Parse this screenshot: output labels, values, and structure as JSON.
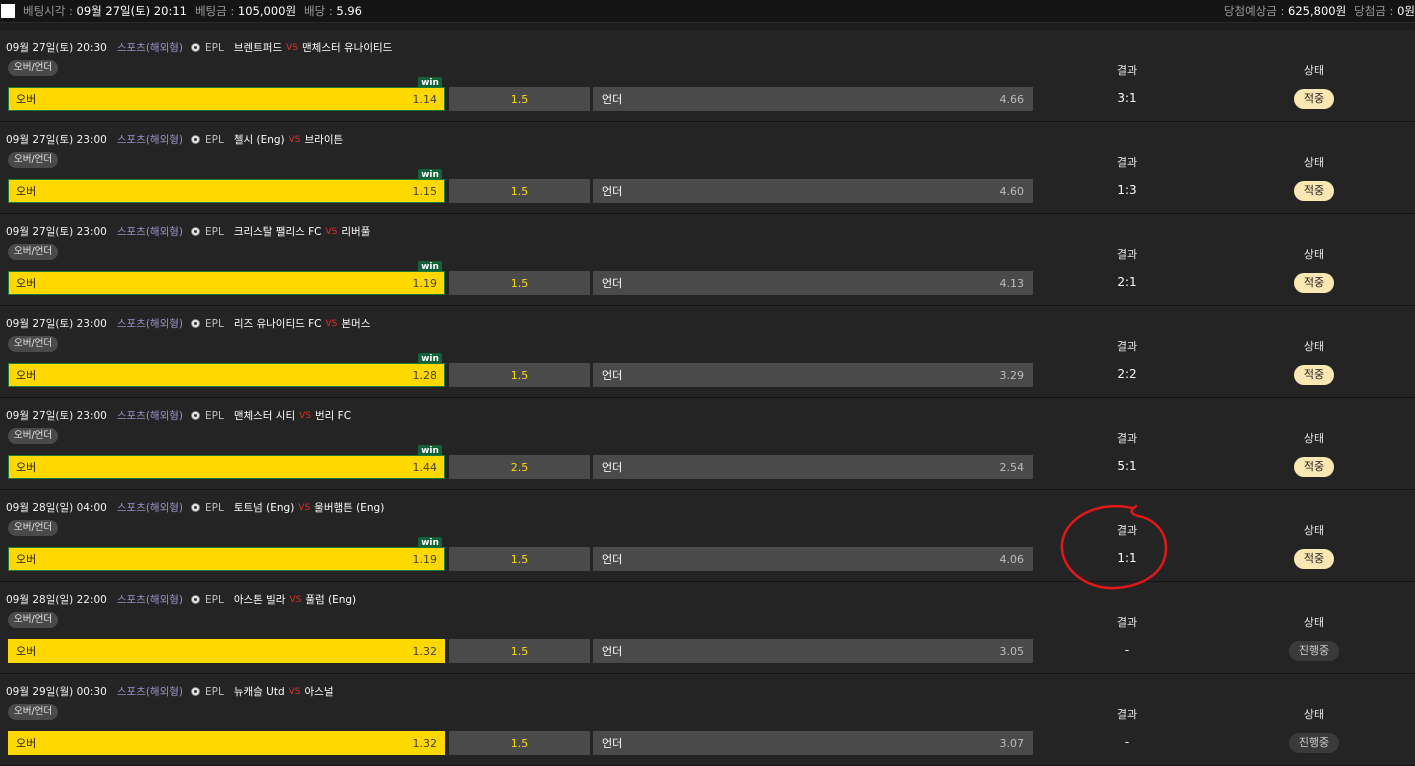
{
  "header": {
    "bet_time_label": "베팅시각 :",
    "bet_time": "09월 27일(토) 20:11",
    "bet_amount_label": "베팅금 :",
    "bet_amount": "105,000원",
    "odds_label": "배당 :",
    "odds": "5.96",
    "expected_label": "당첨예상금 :",
    "expected": "625,800원",
    "won_label": "당첨금 :",
    "won": "0원"
  },
  "labels": {
    "result": "결과",
    "status": "상태",
    "bet_type": "오버/언더",
    "over": "오버",
    "under": "언더",
    "vs": "VS",
    "category": "스포츠(해외형)",
    "league": "EPL",
    "win": "win"
  },
  "colors": {
    "over_bg": "#ffd800",
    "vs": "#e0302a",
    "win_badge": "#13603a",
    "hit_badge": "#fbe7b2",
    "annotation": "#e01818"
  },
  "matches": [
    {
      "date": "09월 27일(토) 20:30",
      "home": "브렌트퍼드",
      "away": "맨체스터 유나이티드",
      "over_odds": "1.14",
      "line": "1.5",
      "under_odds": "4.66",
      "result": "3:1",
      "status": "적중",
      "won": true
    },
    {
      "date": "09월 27일(토) 23:00",
      "home": "첼시 (Eng)",
      "away": "브라이튼",
      "over_odds": "1.15",
      "line": "1.5",
      "under_odds": "4.60",
      "result": "1:3",
      "status": "적중",
      "won": true
    },
    {
      "date": "09월 27일(토) 23:00",
      "home": "크리스탈 팰리스 FC",
      "away": "리버풀",
      "over_odds": "1.19",
      "line": "1.5",
      "under_odds": "4.13",
      "result": "2:1",
      "status": "적중",
      "won": true
    },
    {
      "date": "09월 27일(토) 23:00",
      "home": "리즈 유나이티드 FC",
      "away": "본머스",
      "over_odds": "1.28",
      "line": "1.5",
      "under_odds": "3.29",
      "result": "2:2",
      "status": "적중",
      "won": true
    },
    {
      "date": "09월 27일(토) 23:00",
      "home": "맨체스터 시티",
      "away": "번리 FC",
      "over_odds": "1.44",
      "line": "2.5",
      "under_odds": "2.54",
      "result": "5:1",
      "status": "적중",
      "won": true
    },
    {
      "date": "09월 28일(일) 04:00",
      "home": "토트넘 (Eng)",
      "away": "울버햄튼 (Eng)",
      "over_odds": "1.19",
      "line": "1.5",
      "under_odds": "4.06",
      "result": "1:1",
      "status": "적중",
      "won": true
    },
    {
      "date": "09월 28일(일) 22:00",
      "home": "아스톤 빌라",
      "away": "풀럼 (Eng)",
      "over_odds": "1.32",
      "line": "1.5",
      "under_odds": "3.05",
      "result": "-",
      "status": "진행중",
      "won": false
    },
    {
      "date": "09월 29일(월) 00:30",
      "home": "뉴캐슬 Utd",
      "away": "아스널",
      "over_odds": "1.32",
      "line": "1.5",
      "under_odds": "3.07",
      "result": "-",
      "status": "진행중",
      "won": false
    }
  ]
}
